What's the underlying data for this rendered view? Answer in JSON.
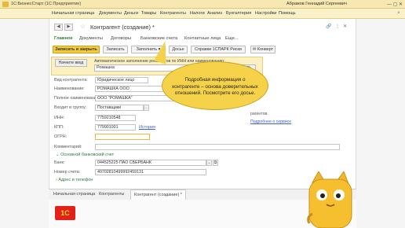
{
  "titlebar": {
    "app": "1С:БизнесСтарт   (1С:Предприятие)",
    "user": "Абрамов Геннадий Сергеевич",
    "window_buttons": "— ▢ ✕"
  },
  "menu": {
    "items": [
      "Начальная страница",
      "Документы",
      "Деньги",
      "Товары",
      "Контрагенты",
      "Налоги",
      "Анализ",
      "Бухгалтерия",
      "Настройки",
      "Помощь"
    ]
  },
  "form": {
    "title": "Контрагент (создание) *",
    "tabs": [
      "Главное",
      "Документы",
      "Договоры",
      "Банковские счета",
      "Контактные лица",
      "Еще..."
    ],
    "toolbar": {
      "save_close": "Записать и закрыть",
      "save": "Записать",
      "fill": "Заполнить",
      "dossier": "Досье",
      "spark": "Справки 1СПАРК Риски",
      "envelope": "Конверт"
    },
    "autofill": {
      "start_label": "Начните ввод",
      "hint": "Автоматическое заполнение реквизитов по ИНН или наименованию:",
      "query": "Ромашка",
      "fill_button": "Заполнить"
    },
    "fields": {
      "kind_label": "Вид контрагента:",
      "kind_value": "Юридическое лицо",
      "name_label": "Наименование:",
      "name_value": "РОМАШКА ООО",
      "fullname_label": "Полное наименование:",
      "fullname_value": "ООО \"РОМАШКА\"",
      "group_label": "Входит в группу:",
      "group_value": "Поставщики",
      "inn_label": "ИНН:",
      "inn_value": "7759210548",
      "kpp_label": "КПП:",
      "kpp_value": "779901001",
      "history_link": "История",
      "ogrn_label": "ОГРН:",
      "ogrn_value": "",
      "comment_label": "Комментарий:",
      "comment_value": "",
      "bank_section": "Основной банковский счет",
      "bank_label": "Банк:",
      "bank_value": "044525225 ПАО СБЕРБАНК",
      "account_label": "Номер счета:",
      "account_value": "40702810499992459131",
      "address_section": "Адрес и телефон"
    },
    "info_links": {
      "contractors": "рагентов.",
      "service": "Подробнее о сервисе"
    }
  },
  "callout": {
    "text": "Подробная информация о контрагенте – основа доверительных отношений. Посмотрите его досье."
  },
  "bottom_tabs": [
    "Начальная страница",
    "Контрагенты",
    "Контрагент (создание) *"
  ],
  "footer": {
    "logo": "1С"
  }
}
